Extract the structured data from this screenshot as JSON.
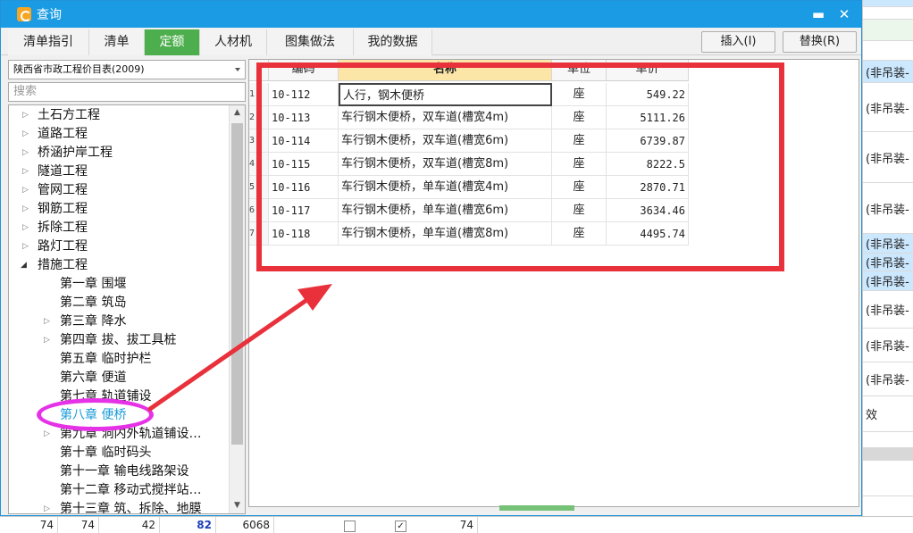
{
  "window": {
    "title": "查询",
    "minimize_glyph": "▬",
    "close_glyph": "✕"
  },
  "tabs": [
    "清单指引",
    "清单",
    "定额",
    "人材机",
    "图集做法",
    "我的数据"
  ],
  "active_tab": "定额",
  "buttons": {
    "insert": "插入(I)",
    "replace": "替换(R)"
  },
  "left": {
    "catalog": "陕西省市政工程价目表(2009)",
    "search_placeholder": "搜索",
    "tree": [
      "土石方工程",
      "道路工程",
      "桥涵护岸工程",
      "隧道工程",
      "管网工程",
      "钢筋工程",
      "拆除工程",
      "路灯工程",
      "措施工程",
      "第一章 围堰",
      "第二章 筑岛",
      "第三章 降水",
      "第四章 拔、拔工具桩",
      "第五章 临时护栏",
      "第六章 便道",
      "第七章 轨道铺设",
      "第八章 便桥",
      "第九章 洞内外轨道铺设…",
      "第十章 临时码头",
      "第十一章 输电线路架设",
      "第十二章 移动式搅拌站…",
      "第十三章 筑、拆除、地膜"
    ],
    "selected": "第八章 便桥"
  },
  "grid": {
    "headers": {
      "code": "编码",
      "name": "名称",
      "unit": "单位",
      "price": "单价"
    },
    "rows": [
      {
        "idx": "1",
        "code": "10-112",
        "name": "人行，钢木便桥",
        "unit": "座",
        "price": "549.22"
      },
      {
        "idx": "2",
        "code": "10-113",
        "name": "车行钢木便桥，双车道(槽宽4m)",
        "unit": "座",
        "price": "5111.26"
      },
      {
        "idx": "3",
        "code": "10-114",
        "name": "车行钢木便桥，双车道(槽宽6m)",
        "unit": "座",
        "price": "6739.87"
      },
      {
        "idx": "4",
        "code": "10-115",
        "name": "车行钢木便桥，双车道(槽宽8m)",
        "unit": "座",
        "price": "8222.5"
      },
      {
        "idx": "5",
        "code": "10-116",
        "name": "车行钢木便桥，单车道(槽宽4m)",
        "unit": "座",
        "price": "2870.71"
      },
      {
        "idx": "6",
        "code": "10-117",
        "name": "车行钢木便桥，单车道(槽宽6m)",
        "unit": "座",
        "price": "3634.46"
      },
      {
        "idx": "7",
        "code": "10-118",
        "name": "车行钢木便桥，单车道(槽宽8m)",
        "unit": "座",
        "price": "4495.74"
      }
    ]
  },
  "background": {
    "right_cells": [
      "(非吊装-",
      "(非吊装-",
      "(非吊装-",
      "(非吊装-",
      "(非吊装-",
      "(非吊装-",
      "(非吊装-",
      "(非吊装-",
      "(非吊装-",
      "(非吊装-",
      "效"
    ],
    "bottom_cells": [
      "74",
      "74",
      "42",
      "82",
      "6068",
      "74"
    ]
  },
  "colors": {
    "accent_blue": "#1b9be3",
    "active_tab_green": "#4cae4c",
    "annotation_red": "#e8313b",
    "annotation_pink": "#e632e6"
  }
}
